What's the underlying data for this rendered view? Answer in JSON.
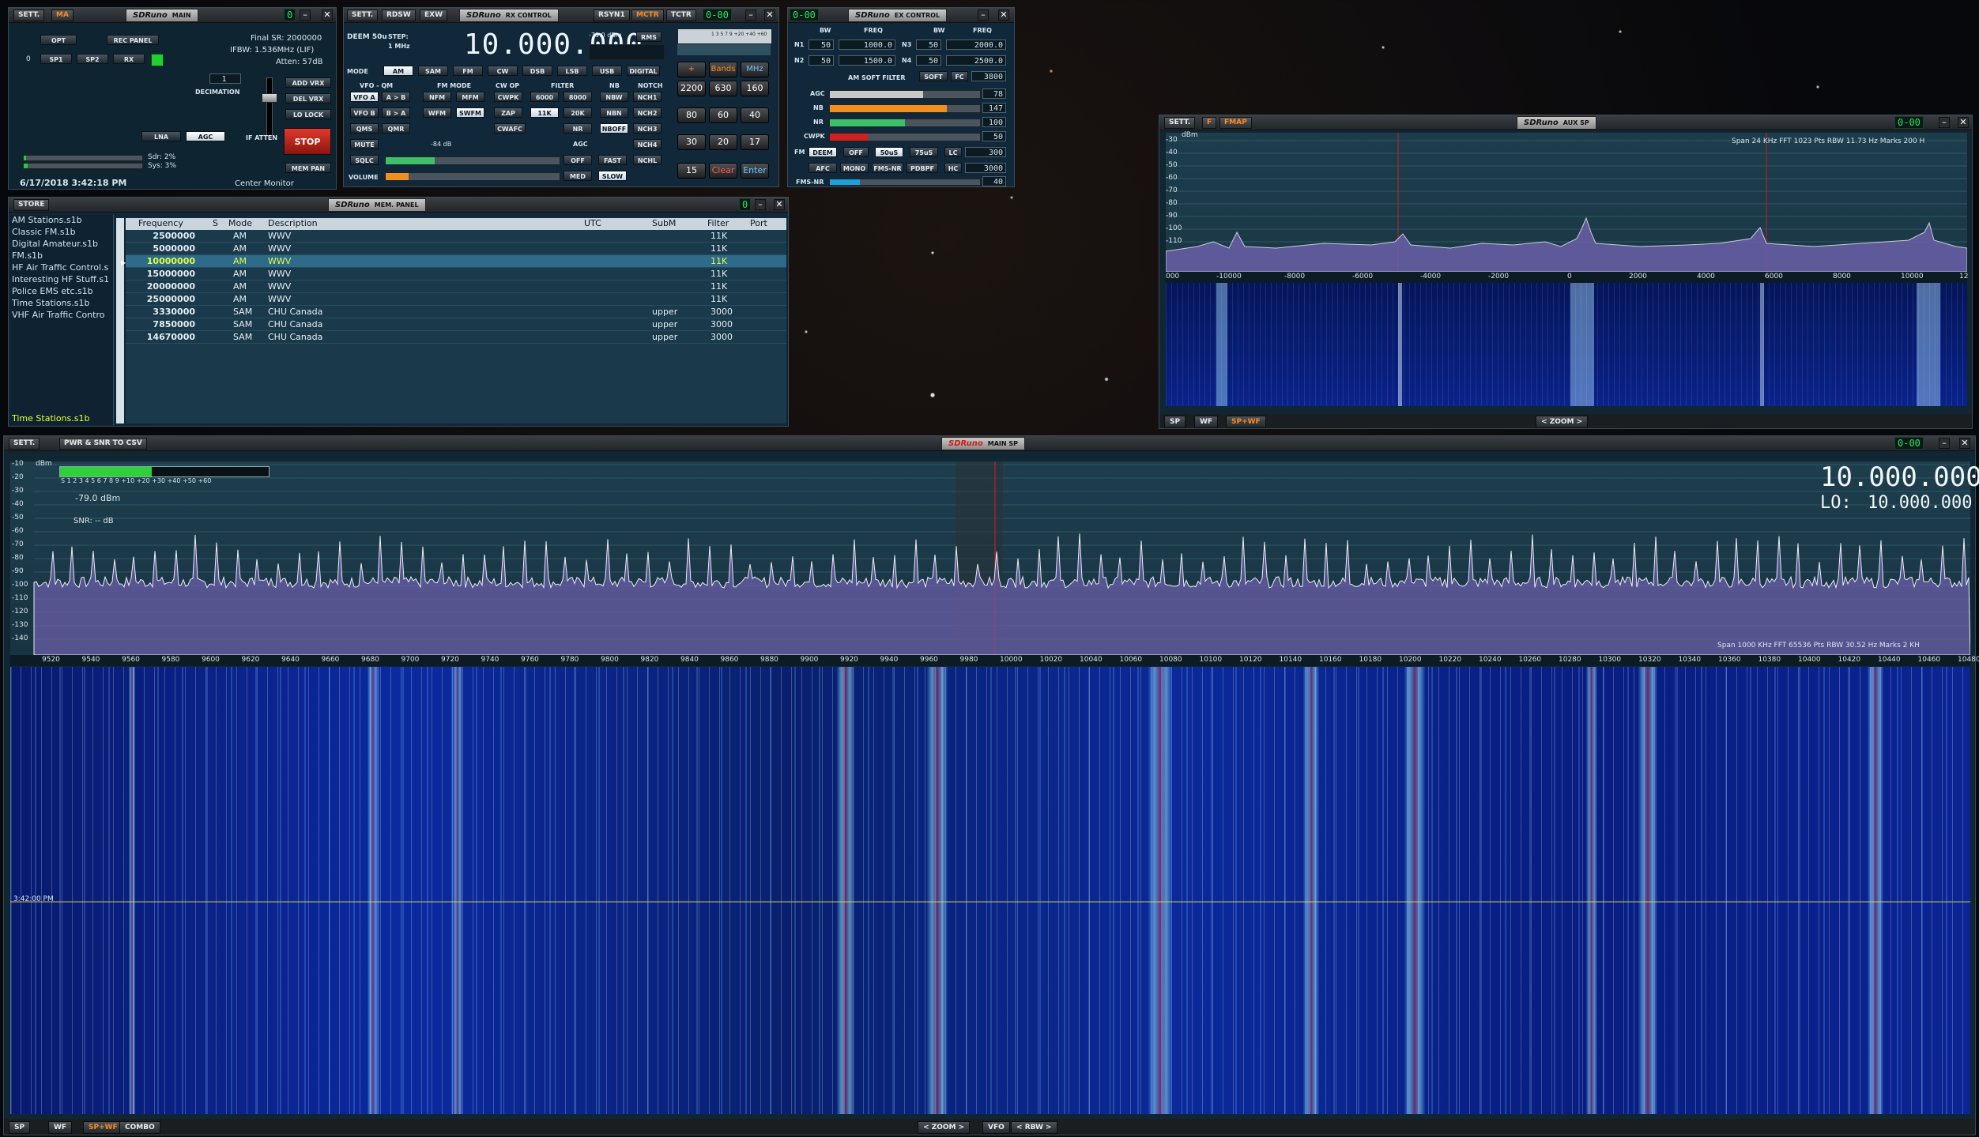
{
  "main_panel": {
    "sett": "SETT.",
    "ma": "MA",
    "logo": "SDRuno",
    "title": "MAIN",
    "lcd": "0",
    "opt": "OPT",
    "rec_panel": "REC PANEL",
    "sp1": "SP1",
    "sp2": "SP2",
    "rx": "RX",
    "zero": "0",
    "final_sr": "Final SR: 2000000",
    "ifbw": "IFBW: 1.536MHz (LIF)",
    "atten": "Atten: 57dB",
    "decimation_value": "1",
    "decimation_label": "DECIMATION",
    "add_vrx": "ADD VRX",
    "del_vrx": "DEL VRX",
    "lo_lock": "LO LOCK",
    "lna": "LNA",
    "agc": "AGC",
    "if_atten": "IF ATTEN",
    "stop": "STOP",
    "mem_pan": "MEM PAN",
    "sdr_load": "Sdr: 2%",
    "sys_load": "Sys: 3%",
    "datetime": "6/17/2018 3:42:18 PM",
    "mode_label": "Center Monitor"
  },
  "rx_control": {
    "sett": "SETT.",
    "rdsw": "RDSW",
    "exw": "EXW",
    "logo": "SDRuno",
    "title": "RX CONTROL",
    "rsyn1": "RSYN1",
    "mctr": "MCTR",
    "tctr": "TCTR",
    "lcd": "0-00",
    "deem": "DEEM 50u",
    "step_label": "STEP:",
    "step_value": "1 MHz",
    "frequency": "10.000.000",
    "level": "-79.0 dBm",
    "rms": "RMS",
    "mode_label": "MODE",
    "modes": [
      "AM",
      "SAM",
      "FM",
      "CW",
      "DSB",
      "LSB",
      "USB",
      "DIGITAL"
    ],
    "vfo_qm": "VFO - QM",
    "fm_mode": "FM MODE",
    "cw_op": "CW OP",
    "filter": "FILTER",
    "nb": "NB",
    "notch": "NOTCH",
    "vfo_a": "VFO A",
    "a_to_b": "A > B",
    "nfm": "NFM",
    "mfm": "MFM",
    "cwpk": "CWPK",
    "f6000": "6000",
    "f8000": "8000",
    "nbw": "NBW",
    "nch1": "NCH1",
    "vfo_b": "VFO B",
    "b_to_a": "B > A",
    "wfm": "WFM",
    "swfm": "SWFM",
    "zap": "ZAP",
    "f11k": "11K",
    "f20k": "20K",
    "nbn": "NBN",
    "nch2": "NCH2",
    "qms": "QMS",
    "qmr": "QMR",
    "cwafc": "CWAFC",
    "nr": "NR",
    "nboff": "NBOFF",
    "nch3": "NCH3",
    "mute": "MUTE",
    "nch4": "NCH4",
    "sqlc": "SQLC",
    "sql_value": "-84 dB",
    "agc": "AGC",
    "off": "OFF",
    "fast": "FAST",
    "nchl": "NCHL",
    "volume": "VOLUME",
    "med": "MED",
    "slow": "SLOW"
  },
  "keypad": {
    "bands": "Bands",
    "mhz": "MHz",
    "keys": [
      "2200",
      "630",
      "160",
      "80",
      "60",
      "40",
      "30",
      "20",
      "17",
      "15"
    ],
    "clear": "Clear",
    "enter": "Enter",
    "scale": "1 3 5 7 9 +20 +40 +60"
  },
  "ex_control": {
    "lcd": "0-00",
    "logo": "SDRuno",
    "title": "EX CONTROL",
    "bw_label": "BW",
    "freq_label": "FREQ",
    "n1": "N1",
    "n1_bw": "50",
    "n1_freq": "1000.0",
    "n2": "N2",
    "n2_bw": "50",
    "n2_freq": "1500.0",
    "n3": "N3",
    "n3_bw": "50",
    "n3_freq": "2000.0",
    "n4": "N4",
    "n4_bw": "50",
    "n4_freq": "2500.0",
    "am_soft_filter": "AM SOFT FILTER",
    "soft": "SOFT",
    "fc": "FC",
    "fc_value": "3800",
    "agc": "AGC",
    "agc_value": "78",
    "nb": "NB",
    "nb_value": "147",
    "nr": "NR",
    "nr_value": "100",
    "cwpk": "CWPK",
    "cwpk_value": "50",
    "fm": "FM",
    "deem": "DEEM",
    "off": "OFF",
    "d50": "50uS",
    "d75": "75uS",
    "lc": "LC",
    "lc_value": "300",
    "afc": "AFC",
    "mono": "MONO",
    "fms_nr": "FMS-NR",
    "pdbpf": "PDBPF",
    "hc": "HC",
    "hc_value": "3000",
    "fms_nr_label": "FMS-NR",
    "fms_nr_value": "40"
  },
  "mem_panel": {
    "store": "STORE",
    "logo": "SDRuno",
    "title": "MEM. PANEL",
    "lcd": "0",
    "files": [
      "AM Stations.s1b",
      "Classic FM.s1b",
      "Digital Amateur.s1b",
      "FM.s1b",
      "HF Air Traffic Control.s",
      "Interesting HF Stuff.s1",
      "Police EMS etc.s1b",
      "Time Stations.s1b",
      "VHF Air Traffic Contro"
    ],
    "selected_file": "Time Stations.s1b",
    "columns": [
      "Frequency",
      "S",
      "Mode",
      "Description",
      "UTC",
      "SubM",
      "Filter",
      "Port"
    ],
    "rows": [
      {
        "freq": "2500000",
        "s": "",
        "mode": "AM",
        "desc": "WWV",
        "utc": "",
        "subm": "",
        "filter": "11K",
        "port": ""
      },
      {
        "freq": "5000000",
        "s": "",
        "mode": "AM",
        "desc": "WWV",
        "utc": "",
        "subm": "",
        "filter": "11K",
        "port": ""
      },
      {
        "freq": "10000000",
        "s": "",
        "mode": "AM",
        "desc": "WWV",
        "utc": "",
        "subm": "",
        "filter": "11K",
        "port": ""
      },
      {
        "freq": "15000000",
        "s": "",
        "mode": "AM",
        "desc": "WWV",
        "utc": "",
        "subm": "",
        "filter": "11K",
        "port": ""
      },
      {
        "freq": "20000000",
        "s": "",
        "mode": "AM",
        "desc": "WWV",
        "utc": "",
        "subm": "",
        "filter": "11K",
        "port": ""
      },
      {
        "freq": "25000000",
        "s": "",
        "mode": "AM",
        "desc": "WWV",
        "utc": "",
        "subm": "",
        "filter": "11K",
        "port": ""
      },
      {
        "freq": "3330000",
        "s": "",
        "mode": "SAM",
        "desc": "CHU Canada",
        "utc": "",
        "subm": "upper",
        "filter": "3000",
        "port": ""
      },
      {
        "freq": "7850000",
        "s": "",
        "mode": "SAM",
        "desc": "CHU Canada",
        "utc": "",
        "subm": "upper",
        "filter": "3000",
        "port": ""
      },
      {
        "freq": "14670000",
        "s": "",
        "mode": "SAM",
        "desc": "CHU Canada",
        "utc": "",
        "subm": "upper",
        "filter": "3000",
        "port": ""
      }
    ],
    "selected_row": 2
  },
  "aux_sp": {
    "sett": "SETT.",
    "f": "F",
    "fmap": "FMAP",
    "logo": "SDRuno",
    "title": "AUX SP",
    "lcd": "0-00",
    "dbm": "dBm",
    "y_ticks": [
      "-30",
      "-40",
      "-50",
      "-60",
      "-70",
      "-80",
      "-90",
      "-100",
      "-110"
    ],
    "info": "Span 24 KHz   FFT 1023 Pts   RBW 11.73 Hz   Marks 200 H",
    "x_ticks": [
      "000",
      "-10000",
      "-8000",
      "-6000",
      "-4000",
      "-2000",
      "0",
      "2000",
      "4000",
      "6000",
      "8000",
      "10000",
      "12"
    ],
    "sp": "SP",
    "wf": "WF",
    "spwf": "SP+WF",
    "zoom": "ZOOM"
  },
  "main_sp": {
    "sett": "SETT.",
    "pwr_csv": "PWR & SNR TO CSV",
    "logo": "SDRuno",
    "title": "MAIN SP",
    "lcd": "0-00",
    "dbm": "dBm",
    "y_ticks": [
      "-10",
      "-20",
      "-30",
      "-40",
      "-50",
      "-60",
      "-70",
      "-80",
      "-90",
      "-100",
      "-110",
      "-120",
      "-130",
      "-140"
    ],
    "smeter_scale": "S 1 2 3 4 5 6 7 8 9 +10 +20 +30 +40 +50 +60",
    "level": "-79.0 dBm",
    "snr": "SNR: -- dB",
    "freq": "10.000.000",
    "lo_label": "LO:",
    "lo_freq": "10.000.000",
    "info": "Span 1000 KHz   FFT 65536 Pts   RBW 30.52 Hz   Marks 2 KH",
    "x_ticks": [
      "9520",
      "9540",
      "9560",
      "9580",
      "9600",
      "9620",
      "9640",
      "9660",
      "9680",
      "9700",
      "9720",
      "9740",
      "9760",
      "9780",
      "9800",
      "9820",
      "9840",
      "9860",
      "9880",
      "9900",
      "9920",
      "9940",
      "9960",
      "9980",
      "10000",
      "10020",
      "10040",
      "10060",
      "10080",
      "10100",
      "10120",
      "10140",
      "10160",
      "10180",
      "10200",
      "10220",
      "10240",
      "10260",
      "10280",
      "10300",
      "10320",
      "10340",
      "10360",
      "10380",
      "10400",
      "10420",
      "10440",
      "10460",
      "10480",
      "10"
    ],
    "time_marker": "3:42:00 PM",
    "sp": "SP",
    "wf": "WF",
    "spwf": "SP+WF",
    "combo": "COMBO",
    "zoom": "ZOOM",
    "vfo": "VFO",
    "rbw": "RBW"
  },
  "colors": {
    "accent": "#ff8a1a",
    "lcd_green": "#2de06a",
    "selected_row": "#e4ff3a",
    "stop_red": "#c21f16"
  }
}
